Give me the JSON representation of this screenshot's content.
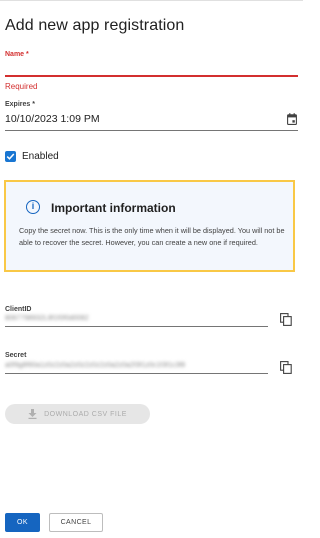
{
  "dialog": {
    "title": "Add new app registration"
  },
  "name_field": {
    "label": "Name *",
    "value": "",
    "error": "Required"
  },
  "expires_field": {
    "label": "Expires *",
    "value": "10/10/2023 1:09 PM",
    "icon": "calendar-icon"
  },
  "enabled": {
    "label": "Enabled",
    "checked": true
  },
  "info_box": {
    "title": "Important information",
    "text": "Copy the secret now. This is the only time when it will be displayed. You will not be able to recover the secret. However, you can create a new one if required.",
    "icon": "info-icon",
    "border_color": "#f9c846",
    "background_color": "#f3f7fd"
  },
  "client_id": {
    "label": "ClientID",
    "value": "8067798932L8f1f0f0d0082",
    "icon": "copy-icon"
  },
  "secret": {
    "label": "Secret",
    "value": "a0f9g8f60a1z0z2z0a2z0z2z0z2z0a2z0a2f3f1z0c1f3f1c3f8",
    "icon": "copy-icon"
  },
  "download_button": {
    "label": "DOWNLOAD CSV FILE",
    "icon": "download-icon",
    "disabled": true
  },
  "footer": {
    "ok_label": "OK",
    "cancel_label": "CANCEL"
  },
  "colors": {
    "primary": "#1565c0",
    "error": "#d32f2f"
  }
}
